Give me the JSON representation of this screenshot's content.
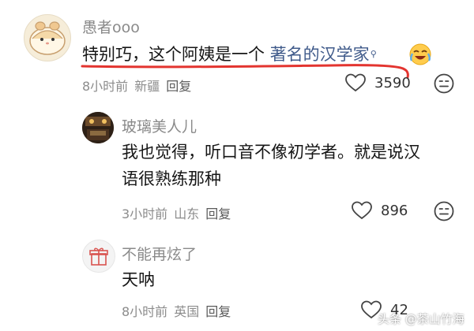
{
  "comments": [
    {
      "username": "愚者ooo",
      "text_plain": "特别巧，这个阿姨是一个 ",
      "text_link": "著名的汉学家",
      "time": "8小时前",
      "location": "新疆",
      "reply_label": "回复",
      "like_count": "3590"
    },
    {
      "username": "玻璃美人儿",
      "text_line1": "我也觉得，听口音不像初学者。就是说汉",
      "text_line2": "语很熟练那种",
      "time": "3小时前",
      "location": "山东",
      "reply_label": "回复",
      "like_count": "896"
    },
    {
      "username": "不能再炫了",
      "text": "天呐",
      "time": "8小时前",
      "location": "英国",
      "reply_label": "回复",
      "like_count": "42"
    }
  ],
  "watermark": "头条 @茶山竹海",
  "colors": {
    "underline": "#e3342f",
    "link": "#3f5a8a"
  }
}
